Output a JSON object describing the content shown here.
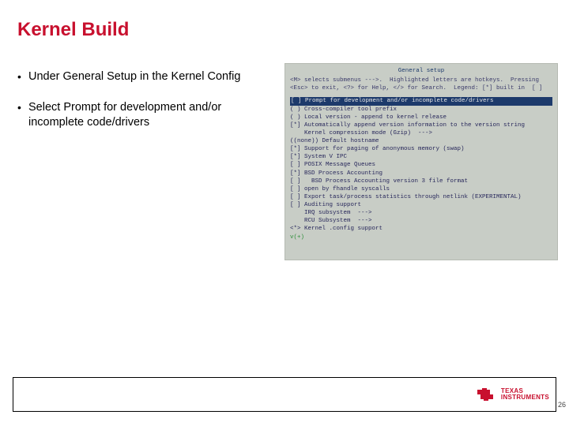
{
  "title": "Kernel Build",
  "bullets": [
    "Under General Setup in the Kernel Config",
    "Select Prompt for development and/or incomplete code/drivers"
  ],
  "screenshot": {
    "header": "General setup",
    "help1": "<M> selects submenus --->.  Highlighted letters are hotkeys.  Pressing",
    "help2": "<Esc> to exit, <?> for Help, </> for Search.  Legend: [*] built in  [ ]",
    "selected": "[ ] Prompt for development and/or incomplete code/drivers",
    "lines": [
      "( ) Cross-compiler tool prefix",
      "( ) Local version - append to kernel release",
      "[*] Automatically append version information to the version string",
      "    Kernel compression mode (Gzip)  --->",
      "((none)) Default hostname",
      "[*] Support for paging of anonymous memory (swap)",
      "[*] System V IPC",
      "[ ] POSIX Message Queues",
      "[*] BSD Process Accounting",
      "[ ]   BSD Process Accounting version 3 file format",
      "[ ] open by fhandle syscalls",
      "[ ] Export task/process statistics through netlink (EXPERIMENTAL)",
      "[ ] Auditing support",
      "    IRQ subsystem  --->",
      "    RCU Subsystem  --->",
      "<*> Kernel .config support"
    ],
    "more": "v(+)"
  },
  "footer": {
    "brand_line1": "TEXAS",
    "brand_line2": "INSTRUMENTS"
  },
  "page_number": "26"
}
